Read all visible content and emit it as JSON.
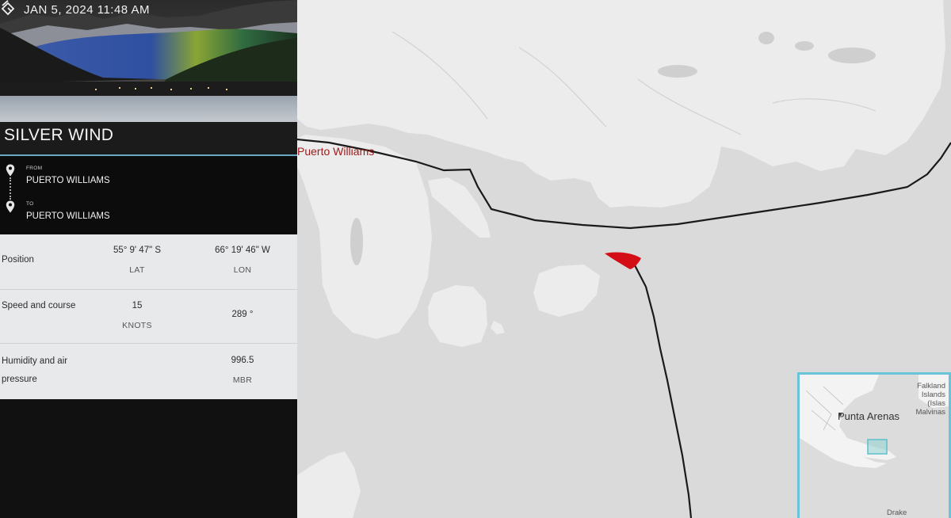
{
  "header": {
    "datetime": "JAN 5, 2024 11:48 AM",
    "logo_icon": "layers-logo-icon"
  },
  "ship": {
    "name": "SILVER WIND"
  },
  "route": {
    "from_label": "FROM",
    "from_port": "PUERTO WILLIAMS",
    "to_label": "TO",
    "to_port": "PUERTO WILLIAMS"
  },
  "stats": {
    "position": {
      "label": "Position",
      "lat_value": "55° 9' 47\" S",
      "lat_unit": "LAT",
      "lon_value": "66° 19' 46\" W",
      "lon_unit": "LON"
    },
    "speed": {
      "label": "Speed and course",
      "speed_value": "15",
      "speed_unit": "KNOTS",
      "course_value": "289 °"
    },
    "weather": {
      "label": "Humidity and air pressure",
      "pressure_value": "996.5",
      "pressure_unit": "MBR"
    }
  },
  "map": {
    "place_label": "Puerto Williams",
    "ship_marker_color": "#d40e16",
    "route_color": "#1a1a1a",
    "water_color": "#dadada",
    "land_color": "#ececec"
  },
  "minimap": {
    "city_label": "Punta Arenas",
    "islands_label_1": "Falkland",
    "islands_label_2": "Islands",
    "islands_label_3": "(Islas",
    "islands_label_4": "Malvinas",
    "sea_label": "Drake",
    "viewport_color": "#5cc0c8",
    "border_color": "#68c4d8"
  }
}
